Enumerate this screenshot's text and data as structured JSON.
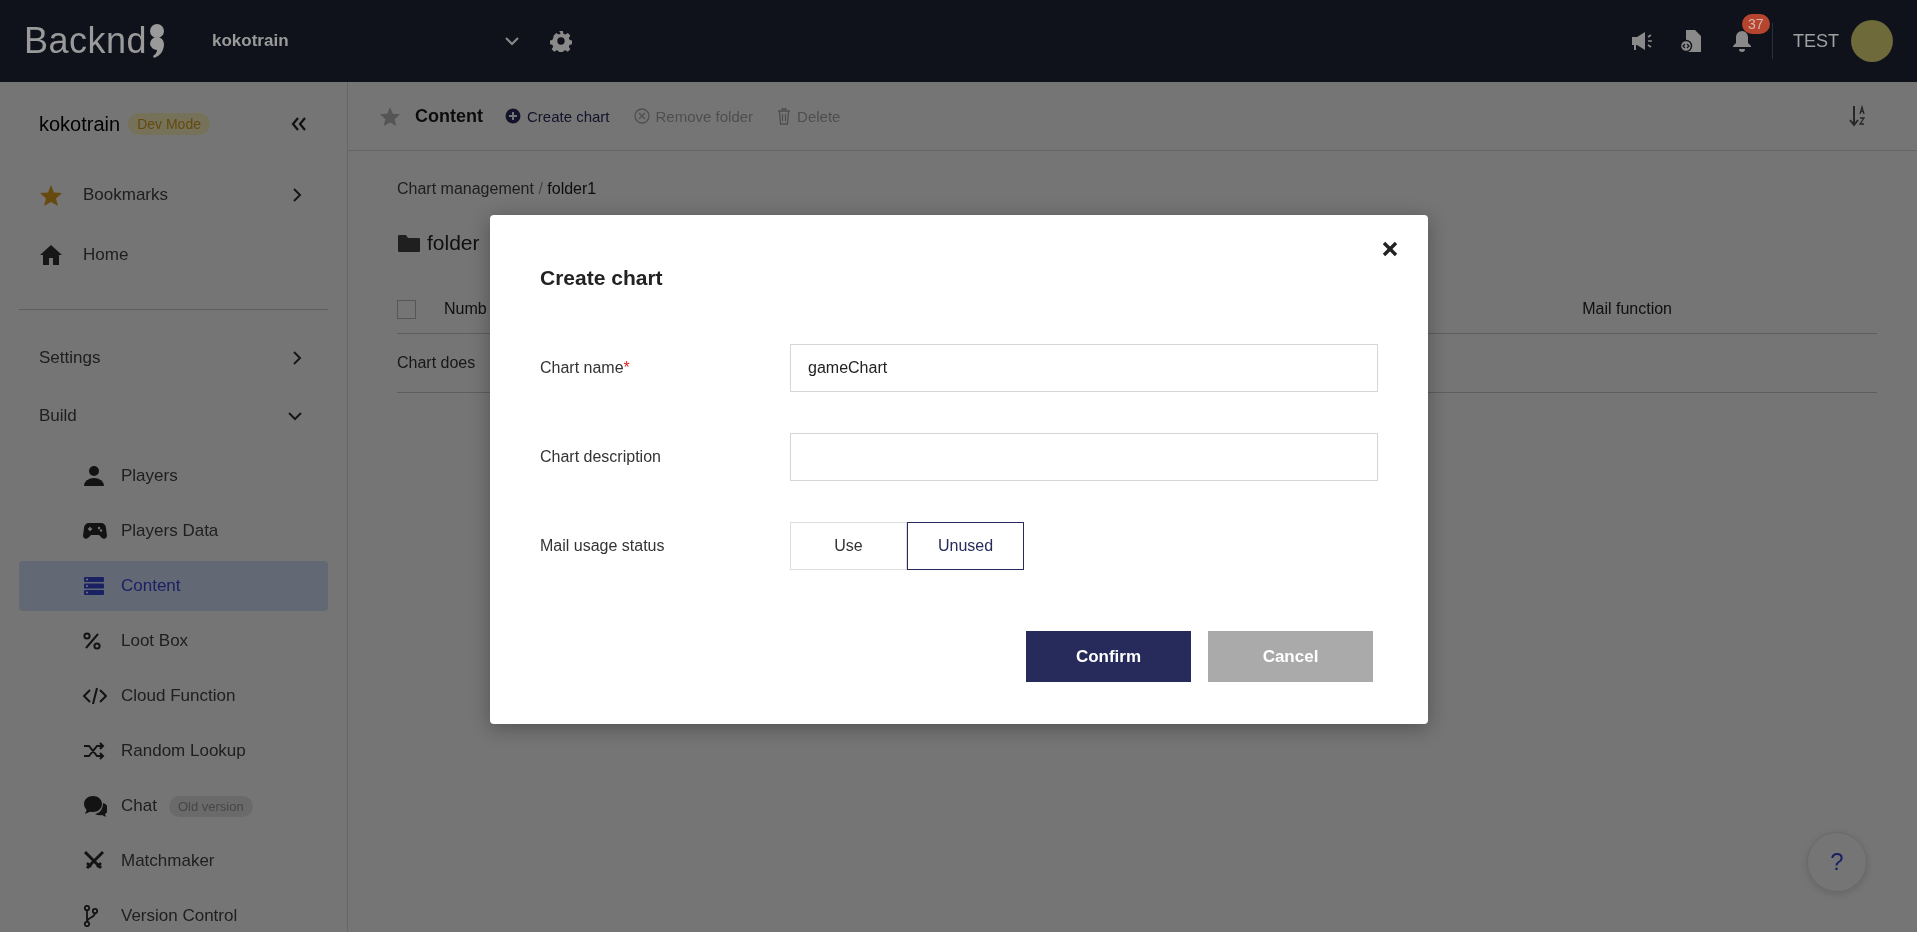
{
  "header": {
    "logo": "Backnd",
    "project": "kokotrain",
    "notification_count": "37",
    "user": "TEST"
  },
  "sidebar": {
    "project": "kokotrain",
    "mode_badge": "Dev Mode",
    "top_items": [
      {
        "label": "Bookmarks",
        "has_arrow": true
      },
      {
        "label": "Home",
        "has_arrow": false
      }
    ],
    "sections": [
      {
        "label": "Settings",
        "expanded": false
      },
      {
        "label": "Build",
        "expanded": true,
        "children": [
          {
            "label": "Players",
            "selected": false
          },
          {
            "label": "Players Data",
            "selected": false
          },
          {
            "label": "Content",
            "selected": true
          },
          {
            "label": "Loot Box",
            "selected": false
          },
          {
            "label": "Cloud Function",
            "selected": false
          },
          {
            "label": "Random Lookup",
            "selected": false
          },
          {
            "label": "Chat",
            "selected": false,
            "badge": "Old version"
          },
          {
            "label": "Matchmaker",
            "selected": false
          },
          {
            "label": "Version Control",
            "selected": false
          }
        ]
      }
    ]
  },
  "toolbar": {
    "title": "Content",
    "actions": [
      {
        "label": "Create chart",
        "disabled": false
      },
      {
        "label": "Remove folder",
        "disabled": true
      },
      {
        "label": "Delete",
        "disabled": true
      }
    ]
  },
  "breadcrumb": {
    "items": [
      "Chart management",
      "folder1"
    ],
    "separator": "/"
  },
  "folder_title": "folder",
  "table": {
    "select_all_checked": false,
    "columns": [
      "Numb",
      "Mail function"
    ],
    "empty_message": "Chart does"
  },
  "modal": {
    "title": "Create chart",
    "fields": [
      {
        "label": "Chart name",
        "required_mark": "*",
        "value": "gameChart"
      },
      {
        "label": "Chart description"
      }
    ],
    "toggle": {
      "label": "Mail usage status",
      "options": [
        {
          "label": "Use",
          "selected": false
        },
        {
          "label": "Unused",
          "selected": true
        }
      ]
    },
    "buttons": [
      {
        "label": "Confirm",
        "kind": "primary"
      },
      {
        "label": "Cancel",
        "kind": "secondary"
      }
    ]
  },
  "help": "?"
}
